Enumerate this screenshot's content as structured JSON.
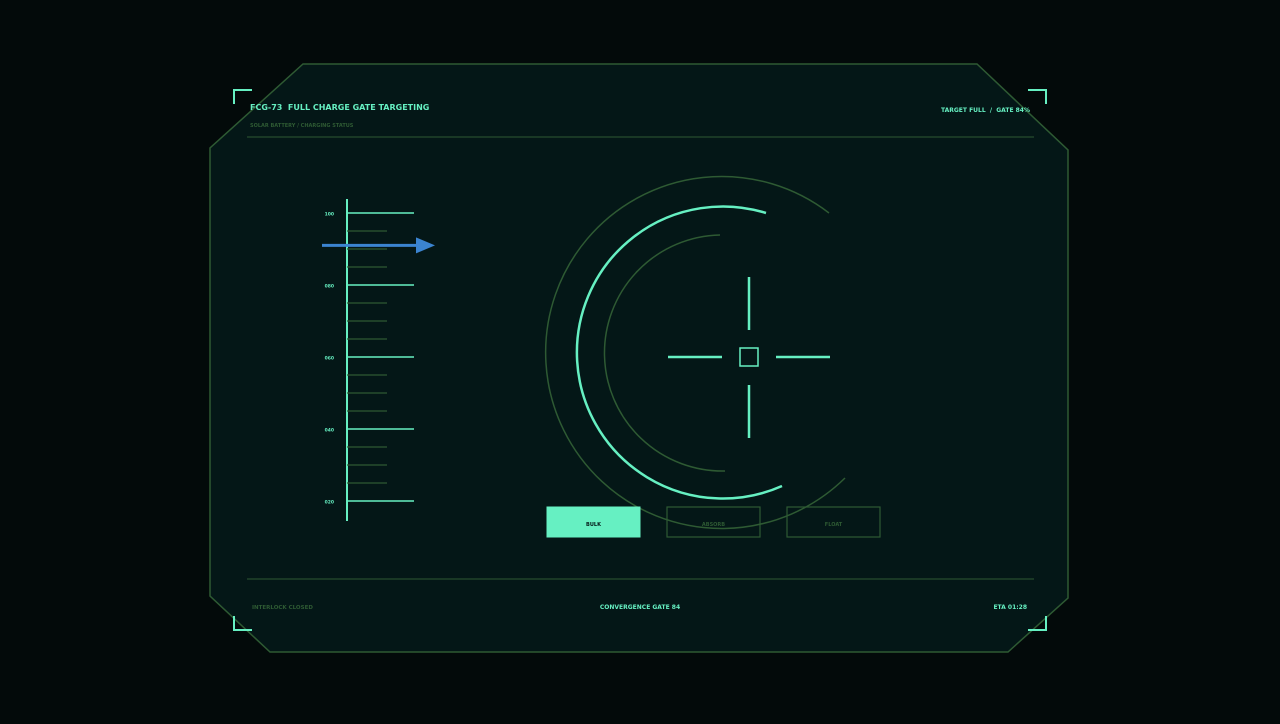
{
  "header": {
    "title": "FCG-73  FULL CHARGE GATE TARGETING",
    "subtitle": "SOLAR BATTERY / CHARGING STATUS",
    "status": "TARGET FULL  /  GATE 84%"
  },
  "gauge": {
    "major_ticks": [
      "100",
      "080",
      "060",
      "040",
      "020"
    ],
    "target_value": 91
  },
  "modes": {
    "items": [
      {
        "label": "BULK",
        "active": true
      },
      {
        "label": "ABSORB",
        "active": false
      },
      {
        "label": "FLOAT",
        "active": false
      }
    ]
  },
  "footer": {
    "left": "INTERLOCK CLOSED",
    "center": "CONVERGENCE GATE 84",
    "right": "ETA 01:28"
  },
  "colors": {
    "bright": "#66f0c2",
    "dim": "#2e5a33",
    "panel": "#041717",
    "arrow": "#3b84d0",
    "background": "#030a0a"
  },
  "icons": {
    "marker": "arrow-right-icon",
    "reticle": "crosshair-icon"
  }
}
